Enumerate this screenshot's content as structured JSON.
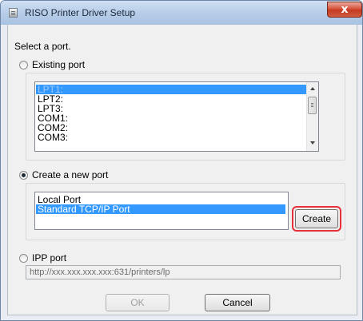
{
  "window": {
    "title": "RISO Printer Driver Setup",
    "close_symbol": "x",
    "icon": "printer-app-icon"
  },
  "prompt": "Select a port.",
  "existing_port": {
    "label": "Existing port",
    "selected": false,
    "items": [
      "LPT1:",
      "LPT2:",
      "LPT3:",
      "COM1:",
      "COM2:",
      "COM3:"
    ],
    "selected_item": "LPT1:"
  },
  "new_port": {
    "label": "Create a new port",
    "selected": true,
    "items": [
      "Local Port",
      "Standard TCP/IP Port"
    ],
    "selected_item": "Standard TCP/IP Port",
    "create_label": "Create"
  },
  "ipp_port": {
    "label": "IPP port",
    "selected": false,
    "value": "http://xxx.xxx.xxx.xxx:631/printers/lp"
  },
  "buttons": {
    "ok": "OK",
    "cancel": "Cancel"
  },
  "colors": {
    "selection": "#3399ff",
    "highlight_ring": "#e8303a",
    "close_button": "#c23a21"
  }
}
